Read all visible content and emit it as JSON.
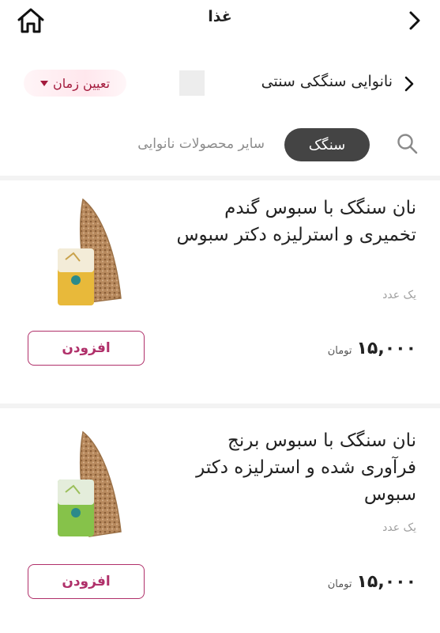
{
  "header": {
    "title": "غذا"
  },
  "shop": {
    "name": "نانوایی سنگکی سنتی",
    "time_button_label": "تعیین زمان"
  },
  "tabs": {
    "active": "سنگک",
    "other": "سایر محصولات نانوایی"
  },
  "products": [
    {
      "title": "نان سنگک با سبوس گندم تخمیری و استرلیزه دکتر سبوس",
      "unit": "یک عدد",
      "price": "۱۵,۰۰۰",
      "currency": "تومان",
      "add_label": "افزودن",
      "package_color": "#e8b93a"
    },
    {
      "title": "نان سنگک با سبوس برنج فرآوری شده و استرلیزه دکتر سبوس",
      "unit": "یک عدد",
      "price": "۱۵,۰۰۰",
      "currency": "تومان",
      "add_label": "افزودن",
      "package_color": "#86c24a"
    }
  ],
  "colors": {
    "accent": "#b0306a",
    "time_chip_text": "#a31a3c",
    "active_tab_bg": "#444444"
  }
}
